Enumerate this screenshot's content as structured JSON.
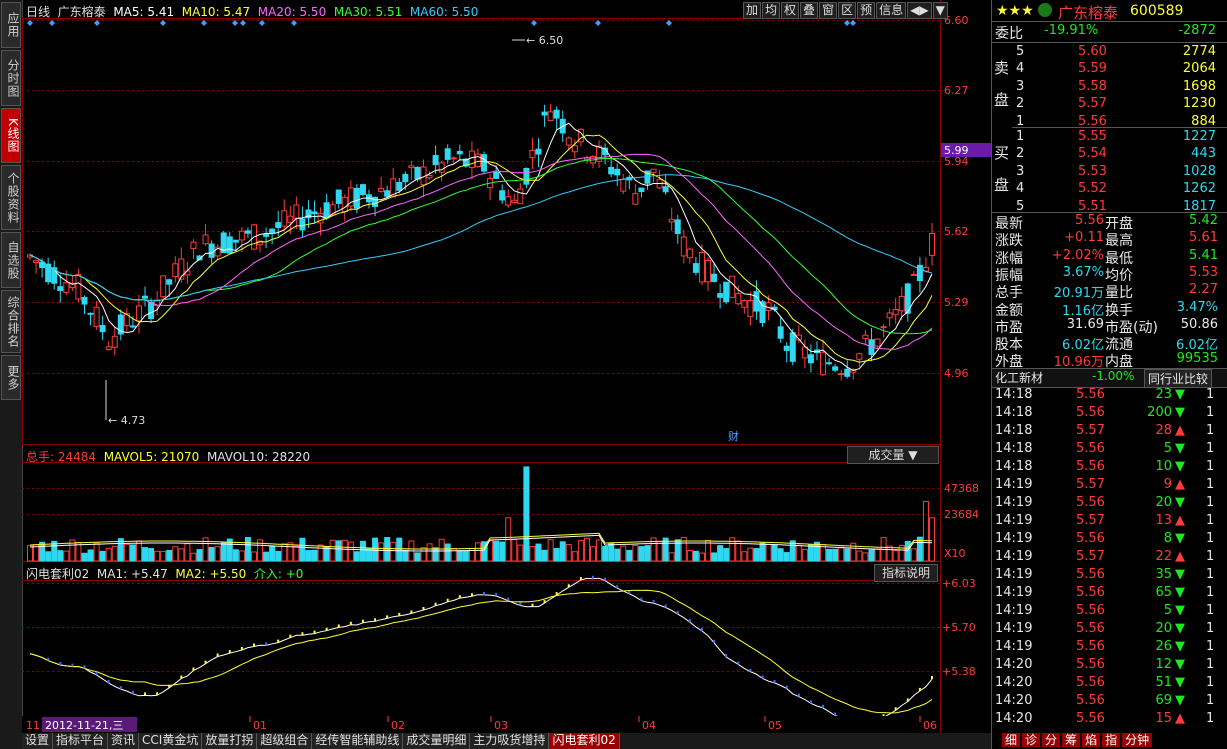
{
  "header": {
    "period": "日线",
    "stock_name": "广东榕泰",
    "ma5": "MA5: 5.41",
    "ma10": "MA10: 5.47",
    "ma20": "MA20: 5.50",
    "ma30": "MA30: 5.51",
    "ma60": "MA60: 5.50",
    "tools": [
      "加",
      "均",
      "权",
      "叠",
      "窗",
      "区",
      "预",
      "信息",
      "◀▶",
      "▼"
    ]
  },
  "price_axis": [
    "6.60",
    "6.27",
    "5.94",
    "5.62",
    "5.29",
    "4.96"
  ],
  "current_price_tag": "5.99",
  "high_mark": "6.50",
  "low_mark": "4.73",
  "fin_marker": "财",
  "volume": {
    "label": "总手",
    "total": "24484",
    "mavol5": "MAVOL5: 21070",
    "mavol10": "MAVOL10: 28220",
    "selector": "成交量",
    "axis": [
      "47368",
      "23684",
      "X10"
    ]
  },
  "indicator": {
    "name": "闪电套利02",
    "ma1": "MA1: +5.47",
    "ma2": "MA2: +5.50",
    "enter": "介入: +0",
    "help": "指标说明",
    "axis": [
      "+6.03",
      "+5.70",
      "+5.38"
    ]
  },
  "date_axis": {
    "left_label": "11",
    "date_highlight": "2012-11-21,三",
    "months": [
      "01",
      "02",
      "03",
      "04",
      "05",
      "06"
    ]
  },
  "leftnav": [
    "应用",
    "分时图",
    "K线图",
    "个股资料",
    "自选股",
    "综合排名",
    "更多"
  ],
  "bottom_tabs": [
    "设置",
    "指标平台",
    "资讯",
    "CCI黄金坑",
    "放量打拐",
    "超级组合",
    "经传智能辅助线",
    "成交量明细",
    "主力吸货增持",
    "闪电套利02"
  ],
  "quote": {
    "stars": "★★★",
    "name": "广东榕泰",
    "code": "600589",
    "weibi_label": "委比",
    "weibi": "-19.91%",
    "weicha": "-2872",
    "sell_label": "卖盘",
    "buy_label": "买盘",
    "sell": [
      {
        "n": "5",
        "p": "5.60",
        "v": "2774"
      },
      {
        "n": "4",
        "p": "5.59",
        "v": "2064"
      },
      {
        "n": "3",
        "p": "5.58",
        "v": "1698"
      },
      {
        "n": "2",
        "p": "5.57",
        "v": "1230"
      },
      {
        "n": "1",
        "p": "5.56",
        "v": "884"
      }
    ],
    "buy": [
      {
        "n": "1",
        "p": "5.55",
        "v": "1227"
      },
      {
        "n": "2",
        "p": "5.54",
        "v": "443"
      },
      {
        "n": "3",
        "p": "5.53",
        "v": "1028"
      },
      {
        "n": "4",
        "p": "5.52",
        "v": "1262"
      },
      {
        "n": "5",
        "p": "5.51",
        "v": "1817"
      }
    ],
    "stats": [
      {
        "l1": "最新",
        "v1": "5.56",
        "c1": "red",
        "l2": "开盘",
        "v2": "5.42",
        "c2": "grn"
      },
      {
        "l1": "涨跌",
        "v1": "+0.11",
        "c1": "red",
        "l2": "最高",
        "v2": "5.61",
        "c2": "red"
      },
      {
        "l1": "涨幅",
        "v1": "+2.02%",
        "c1": "red",
        "l2": "最低",
        "v2": "5.41",
        "c2": "grn"
      },
      {
        "l1": "振幅",
        "v1": "3.67%",
        "c1": "cyan",
        "l2": "均价",
        "v2": "5.53",
        "c2": "red"
      },
      {
        "l1": "总手",
        "v1": "20.91万",
        "c1": "cyan",
        "l2": "量比",
        "v2": "2.27",
        "c2": "red"
      },
      {
        "l1": "金额",
        "v1": "1.16亿",
        "c1": "cyan",
        "l2": "换手",
        "v2": "3.47%",
        "c2": "cyan"
      },
      {
        "l1": "市盈",
        "v1": "31.69",
        "c1": "wht",
        "l2": "市盈(动)",
        "v2": "50.86",
        "c2": "wht"
      },
      {
        "l1": "股本",
        "v1": "6.02亿",
        "c1": "cyan",
        "l2": "流通",
        "v2": "6.02亿",
        "c2": "cyan"
      },
      {
        "l1": "外盘",
        "v1": "10.96万",
        "c1": "red",
        "l2": "内盘",
        "v2": "99535",
        "c2": "grn"
      }
    ],
    "sector": "化工新材",
    "sector_change": "-1.00%",
    "compare_btn": "同行业比较",
    "ticks": [
      {
        "t": "14:18",
        "p": "5.56",
        "v": "23",
        "d": "down"
      },
      {
        "t": "14:18",
        "p": "5.56",
        "v": "200",
        "d": "down"
      },
      {
        "t": "14:18",
        "p": "5.57",
        "v": "28",
        "d": "up"
      },
      {
        "t": "14:18",
        "p": "5.56",
        "v": "5",
        "d": "down"
      },
      {
        "t": "14:18",
        "p": "5.56",
        "v": "10",
        "d": "down"
      },
      {
        "t": "14:19",
        "p": "5.57",
        "v": "9",
        "d": "up"
      },
      {
        "t": "14:19",
        "p": "5.56",
        "v": "20",
        "d": "down"
      },
      {
        "t": "14:19",
        "p": "5.57",
        "v": "13",
        "d": "up"
      },
      {
        "t": "14:19",
        "p": "5.56",
        "v": "8",
        "d": "down"
      },
      {
        "t": "14:19",
        "p": "5.57",
        "v": "22",
        "d": "up"
      },
      {
        "t": "14:19",
        "p": "5.56",
        "v": "35",
        "d": "down"
      },
      {
        "t": "14:19",
        "p": "5.56",
        "v": "65",
        "d": "down"
      },
      {
        "t": "14:19",
        "p": "5.56",
        "v": "5",
        "d": "down"
      },
      {
        "t": "14:19",
        "p": "5.56",
        "v": "20",
        "d": "down"
      },
      {
        "t": "14:19",
        "p": "5.56",
        "v": "26",
        "d": "down"
      },
      {
        "t": "14:20",
        "p": "5.56",
        "v": "12",
        "d": "down"
      },
      {
        "t": "14:20",
        "p": "5.56",
        "v": "51",
        "d": "down"
      },
      {
        "t": "14:20",
        "p": "5.56",
        "v": "69",
        "d": "down"
      },
      {
        "t": "14:20",
        "p": "5.56",
        "v": "15",
        "d": "up"
      }
    ],
    "tick_count": "1",
    "bottom_tabs": [
      "细",
      "诊",
      "分",
      "筹",
      "焰",
      "指",
      "分钟"
    ]
  },
  "colors": {
    "up": "#ff3b3b",
    "down": "#2ed8f0",
    "grid": "#8b0000",
    "ma5": "#ffffff",
    "ma10": "#ffff33",
    "ma20": "#ff66ff",
    "ma30": "#33ff33",
    "ma60": "#33ccff"
  }
}
